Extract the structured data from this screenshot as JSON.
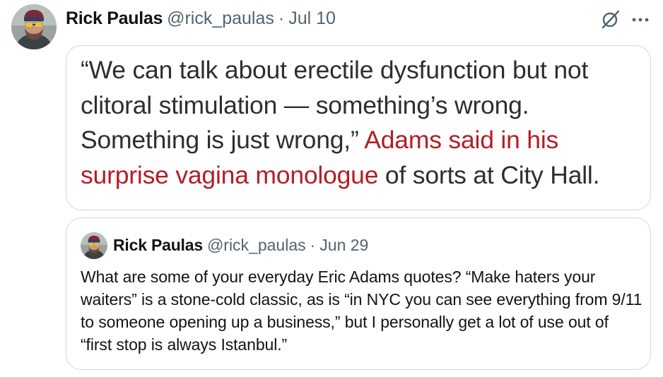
{
  "tweet": {
    "display_name": "Rick Paulas",
    "handle": "@rick_paulas",
    "separator": "·",
    "time": "Jul 10",
    "icons": {
      "grok": "grok-icon",
      "more": "more-icon"
    }
  },
  "media": {
    "text_before": "“We can talk about erectile dysfunction but not clitoral stimulation — something’s wrong. Something is just wrong,” ",
    "link_text": "Adams said in his surprise vagina monologue",
    "text_after": " of sorts at City Hall.",
    "colors": {
      "text": "#2e2e2e",
      "link": "#b31e24"
    }
  },
  "quoted_tweet": {
    "display_name": "Rick Paulas",
    "handle": "@rick_paulas",
    "separator": "·",
    "time": "Jun 29",
    "text": "What are some of your everyday Eric Adams quotes? “Make haters your waiters” is a stone-cold classic, as is “in NYC you can see everything from 9/11 to someone opening up a business,” but I personally get a lot of use out of “first stop is always Istanbul.”"
  }
}
